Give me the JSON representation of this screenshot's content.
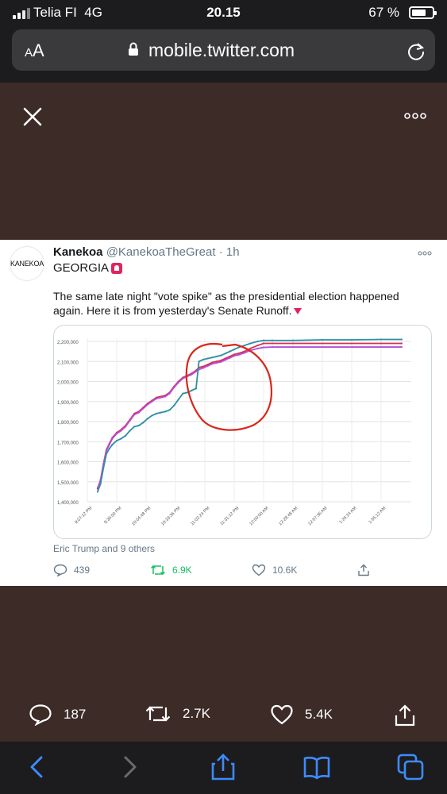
{
  "status": {
    "carrier": "Telia FI",
    "network": "4G",
    "time": "20.15",
    "battery": "67 %"
  },
  "browser": {
    "aa_label": "AA",
    "url": "mobile.twitter.com"
  },
  "tweet": {
    "avatar_text": "KANEKOA",
    "display_name": "Kanekoa",
    "handle": "@KanekoaTheGreat",
    "age": "· 1h",
    "line1": "GEORGIA",
    "text": "The same late night \"vote spike\" as the presidential election happened again. Here it is from yesterday's Senate Runoff.",
    "liked_by": "Eric Trump and 9 others",
    "replies": "439",
    "retweets": "6.9K",
    "likes": "10.6K"
  },
  "outer_actions": {
    "replies": "187",
    "retweets": "2.7K",
    "likes": "5.4K"
  },
  "colors": {
    "retweet_green": "#17bf63",
    "chart_red": "#d62f55",
    "chart_teal": "#2e8fa3",
    "chart_purple": "#b44fd6",
    "annotation_red": "#d9261c"
  },
  "chart_data": {
    "type": "line",
    "title": "",
    "xlabel": "",
    "ylabel": "",
    "ylim": [
      1400000,
      2200000
    ],
    "yticks": [
      "1,400,000",
      "1,500,000",
      "1,600,000",
      "1,700,000",
      "1,800,000",
      "1,900,000",
      "2,000,000",
      "2,100,000",
      "2,200,000"
    ],
    "xticks": [
      "9:07:12 PM",
      "9:36:00 PM",
      "10:04:48 PM",
      "10:33:36 PM",
      "11:02:24 PM",
      "11:31:12 PM",
      "12:00:00 AM",
      "12:28:48 AM",
      "12:57:36 AM",
      "1:26:24 AM",
      "1:55:12 AM"
    ],
    "x_index": [
      0.35,
      0.45,
      0.55,
      0.65,
      0.75,
      0.85,
      1.0,
      1.15,
      1.3,
      1.45,
      1.6,
      1.75,
      1.9,
      2.05,
      2.2,
      2.35,
      2.5,
      2.65,
      2.8,
      2.95,
      3.1,
      3.25,
      3.4,
      3.55,
      3.7,
      3.8,
      3.95,
      4.1,
      4.25,
      4.4,
      4.55,
      4.7,
      4.85,
      5.0,
      5.15,
      5.35,
      5.55,
      5.8,
      6.0,
      6.3,
      7.0,
      8.0,
      9.0,
      10.0,
      10.7
    ],
    "series": [
      {
        "color": "red",
        "values": [
          1465000,
          1510000,
          1590000,
          1660000,
          1690000,
          1720000,
          1745000,
          1760000,
          1780000,
          1810000,
          1840000,
          1850000,
          1870000,
          1890000,
          1905000,
          1920000,
          1925000,
          1930000,
          1945000,
          1975000,
          2000000,
          2020000,
          2030000,
          2040000,
          2055000,
          2070000,
          2075000,
          2085000,
          2095000,
          2100000,
          2105000,
          2115000,
          2125000,
          2135000,
          2140000,
          2150000,
          2165000,
          2180000,
          2190000,
          2190000,
          2190000,
          2190000,
          2190000,
          2190000,
          2190000
        ]
      },
      {
        "color": "purple",
        "values": [
          1470000,
          1505000,
          1585000,
          1655000,
          1685000,
          1715000,
          1740000,
          1755000,
          1775000,
          1805000,
          1835000,
          1845000,
          1865000,
          1885000,
          1900000,
          1915000,
          1920000,
          1925000,
          1940000,
          1970000,
          1995000,
          2015000,
          2025000,
          2035000,
          2050000,
          2060000,
          2068000,
          2078000,
          2088000,
          2093000,
          2098000,
          2108000,
          2118000,
          2128000,
          2133000,
          2143000,
          2155000,
          2165000,
          2170000,
          2172000,
          2172000,
          2172000,
          2172000,
          2172000,
          2172000
        ]
      },
      {
        "color": "teal",
        "values": [
          1450000,
          1490000,
          1570000,
          1640000,
          1665000,
          1685000,
          1705000,
          1715000,
          1730000,
          1755000,
          1775000,
          1780000,
          1795000,
          1815000,
          1830000,
          1840000,
          1845000,
          1850000,
          1858000,
          1880000,
          1910000,
          1940000,
          1945000,
          1955000,
          1965000,
          2100000,
          2110000,
          2115000,
          2120000,
          2125000,
          2130000,
          2140000,
          2150000,
          2160000,
          2170000,
          2180000,
          2190000,
          2200000,
          2205000,
          2205000,
          2205000,
          2208000,
          2208000,
          2210000,
          2210000
        ]
      }
    ]
  }
}
